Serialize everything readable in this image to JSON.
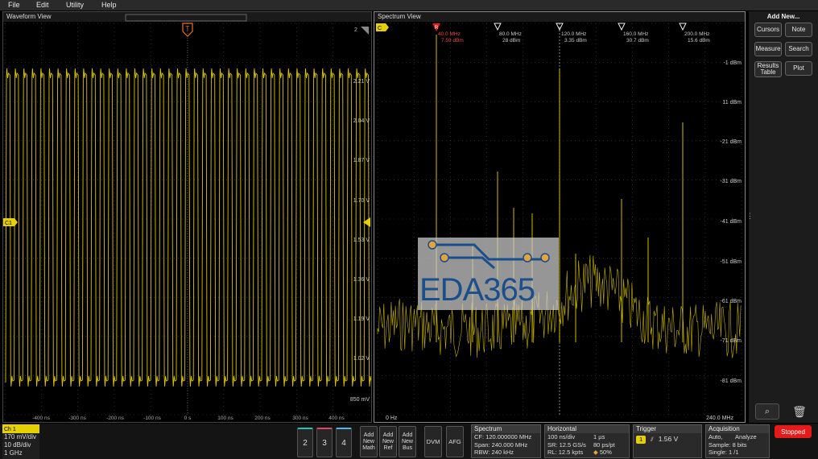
{
  "menu": [
    "File",
    "Edit",
    "Utility",
    "Help"
  ],
  "waveform_view": {
    "title": "Waveform View",
    "channel_marker": "C1",
    "corner_label": "2",
    "trigger_marker": "T",
    "y_labels": [
      "2.21 V",
      "2.04 V",
      "1.87 V",
      "1.70 V",
      "1.53 V",
      "1.36 V",
      "1.19 V",
      "1.02 V",
      "850 mV"
    ],
    "x_labels": [
      "-400 ns",
      "-300 ns",
      "-200 ns",
      "-100 ns",
      "0 s",
      "100 ns",
      "200 ns",
      "300 ns",
      "400 ns"
    ]
  },
  "spectrum_view": {
    "title": "Spectrum View",
    "ref_marker": "R",
    "ch_marker": "C",
    "markers": [
      {
        "freq": "40.0 MHz",
        "level": "7.59 dBm",
        "ref": true
      },
      {
        "freq": "80.0 MHz",
        "level": "28 dBm",
        "ref": false
      },
      {
        "freq": "120.0 MHz",
        "level": "3.35 dBm",
        "ref": false
      },
      {
        "freq": "160.0 MHz",
        "level": "30.7 dBm",
        "ref": false
      },
      {
        "freq": "200.0 MHz",
        "level": "15.6 dBm",
        "ref": false
      }
    ],
    "y_labels": [
      "-1 dBm",
      "11 dBm",
      "-21 dBm",
      "-31 dBm",
      "-41 dBm",
      "-51 dBm",
      "-61 dBm",
      "-71 dBm",
      "-81 dBm"
    ],
    "x_start": "0 Hz",
    "x_end": "240.0 MHz"
  },
  "right_panel": {
    "title": "Add New...",
    "buttons": [
      "Cursors",
      "Note",
      "Measure",
      "Search",
      "Results Table",
      "Plot"
    ]
  },
  "bottom": {
    "ch1": {
      "label": "Ch 1",
      "scale": "170 mV/div",
      "atten": "10 dB/div",
      "bw": "1 GHz"
    },
    "channel_buttons": [
      "2",
      "3",
      "4"
    ],
    "add_buttons": [
      "Add New Math",
      "Add New Ref",
      "Add New Bus"
    ],
    "dvm": "DVM",
    "afg": "AFG",
    "spectrum": {
      "title": "Spectrum",
      "cf": "CF: 120.000000 MHz",
      "span": "Span: 240.000 MHz",
      "rbw": "RBW: 240 kHz"
    },
    "horizontal": {
      "title": "Horizontal",
      "l1a": "100 ns/div",
      "l1b": "1 µs",
      "l2a": "SR: 12.5 GS/s",
      "l2b": "80 ps/pt",
      "l3a": "RL: 12.5 kpts",
      "l3b": "50%"
    },
    "trigger": {
      "title": "Trigger",
      "ch": "1",
      "level": "1.56 V"
    },
    "acquisition": {
      "title": "Acquisition",
      "l1a": "Auto,",
      "l1b": "Analyze",
      "l2": "Sample: 8 bits",
      "l3": "Single: 1 /1"
    },
    "stopped": "Stopped"
  },
  "watermark": {
    "text": "EDA365"
  },
  "colors": {
    "trace": "#e6d000",
    "accent_red": "#e31b1b",
    "ch1": "#e6d000"
  }
}
